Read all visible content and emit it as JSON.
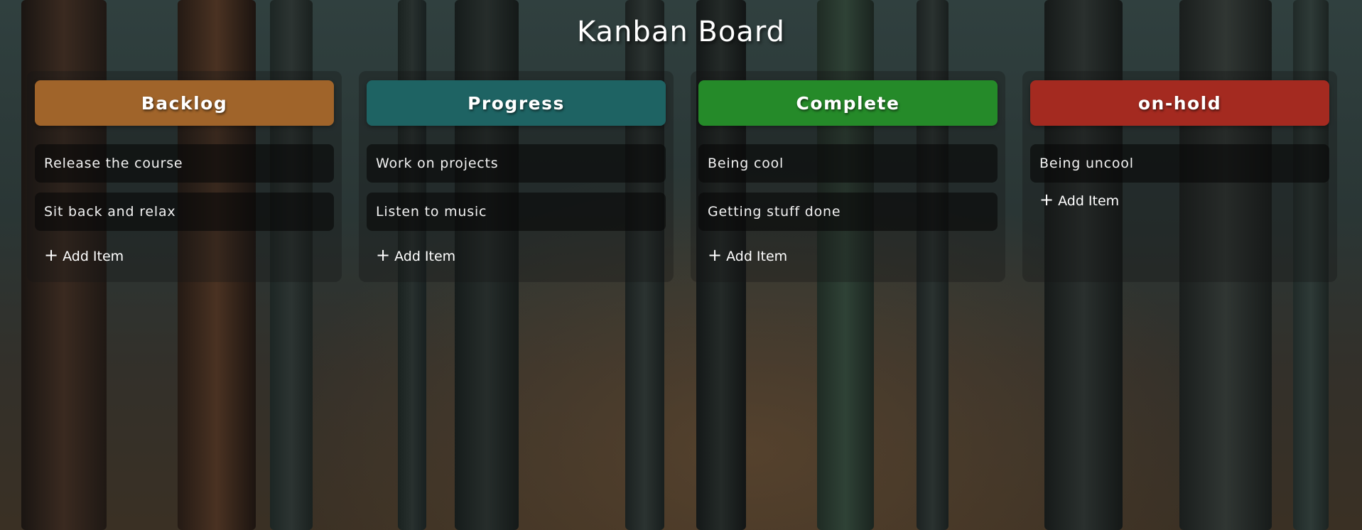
{
  "page": {
    "title": "Kanban Board"
  },
  "board": {
    "columns": [
      {
        "title": "Backlog",
        "color": "#a0642a",
        "items": [
          "Release the course",
          "Sit back and relax"
        ],
        "add_label": "Add Item"
      },
      {
        "title": "Progress",
        "color": "#1e6363",
        "items": [
          "Work on projects",
          "Listen to music"
        ],
        "add_label": "Add Item"
      },
      {
        "title": "Complete",
        "color": "#258a29",
        "items": [
          "Being cool",
          "Getting stuff done"
        ],
        "add_label": "Add Item"
      },
      {
        "title": "on-hold",
        "color": "#a42a20",
        "items": [
          "Being uncool"
        ],
        "add_label": "Add Item"
      }
    ]
  },
  "icons": {
    "add": "plus-icon"
  },
  "background": {
    "description_colors": [
      "#30403f",
      "#3a3024"
    ]
  }
}
